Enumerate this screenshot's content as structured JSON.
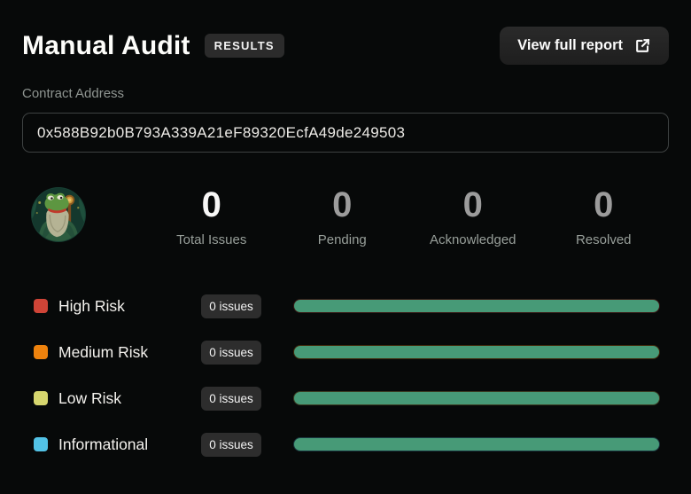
{
  "header": {
    "title": "Manual Audit",
    "badge": "RESULTS",
    "view_report_label": "View full report"
  },
  "contract": {
    "label": "Contract Address",
    "address": "0x588B92b0B793A339A21eF89320EcfA49de249503"
  },
  "stats": [
    {
      "value": "0",
      "label": "Total Issues"
    },
    {
      "value": "0",
      "label": "Pending"
    },
    {
      "value": "0",
      "label": "Acknowledged"
    },
    {
      "value": "0",
      "label": "Resolved"
    }
  ],
  "risks": [
    {
      "label": "High Risk",
      "count": "0 issues",
      "color": "#cf4437",
      "progress": 100
    },
    {
      "label": "Medium Risk",
      "count": "0 issues",
      "color": "#ee820d",
      "progress": 100
    },
    {
      "label": "Low Risk",
      "count": "0 issues",
      "color": "#d6d66e",
      "progress": 100
    },
    {
      "label": "Informational",
      "count": "0 issues",
      "color": "#52c2e6",
      "progress": 100
    }
  ],
  "colors": {
    "background": "#070909",
    "bar_fill": "#479a77",
    "badge_bg": "#2d2d2d",
    "accent_text": "#f7f7f6",
    "muted_text": "#989f9a"
  },
  "icons": {
    "external_link": "external-link-icon",
    "avatar": "frog-wizard-avatar"
  }
}
